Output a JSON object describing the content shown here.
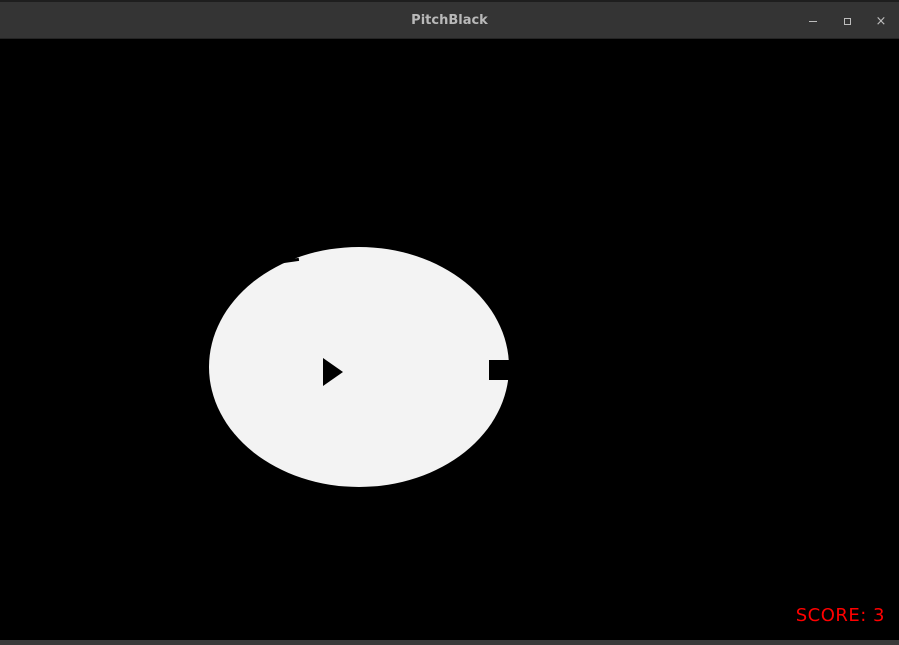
{
  "window": {
    "title": "PitchBlack",
    "controls": {
      "minimize": "–",
      "maximize": "□",
      "close": "×"
    }
  },
  "game": {
    "score_label": "SCORE: 3",
    "colors": {
      "background": "#000000",
      "light": "#f3f3f3",
      "score_text": "#ff0000"
    },
    "icons": {
      "player": "play-triangle-icon",
      "obstacle": "square-block"
    }
  }
}
